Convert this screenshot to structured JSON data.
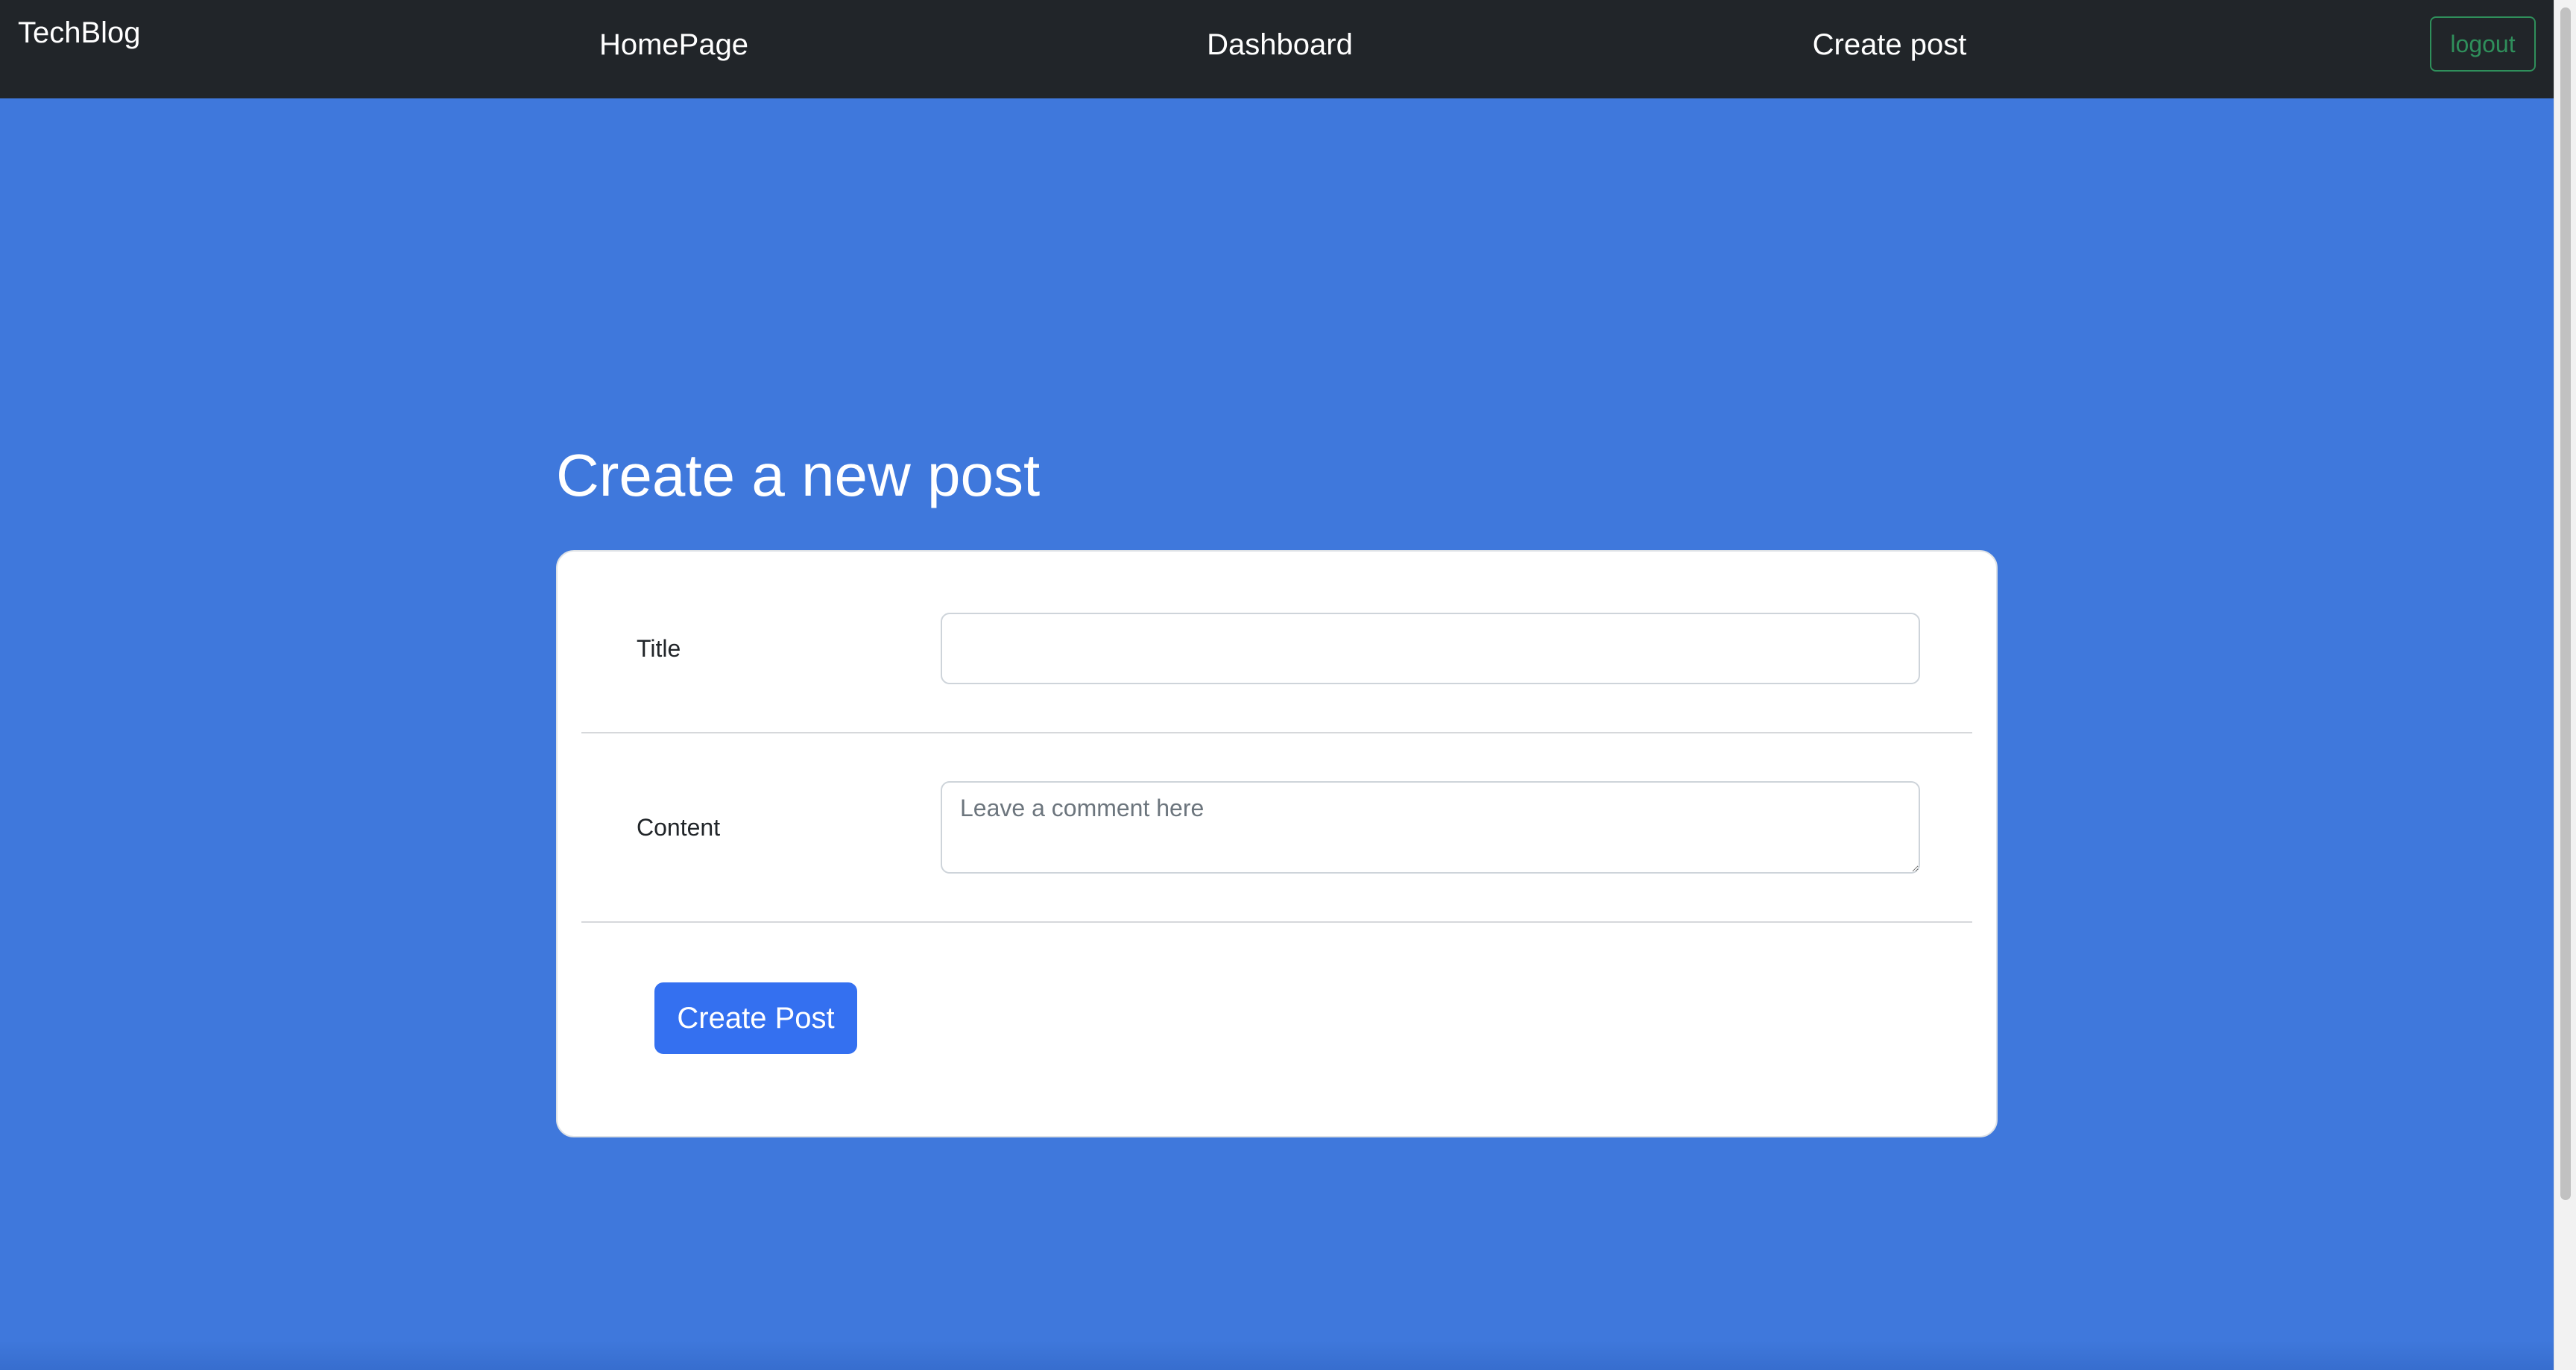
{
  "navbar": {
    "brand": "TechBlog",
    "links": [
      {
        "label": "HomePage"
      },
      {
        "label": "Dashboard"
      },
      {
        "label": "Create post"
      }
    ],
    "logout_label": "logout"
  },
  "page": {
    "heading": "Create a new post"
  },
  "form": {
    "title_label": "Title",
    "title_value": "",
    "content_label": "Content",
    "content_placeholder": "Leave a comment here",
    "content_value": "",
    "submit_label": "Create Post"
  },
  "colors": {
    "background": "#3f78dc",
    "navbar": "#212529",
    "primary_button": "#3470f0",
    "logout_outline": "#2f8f5b"
  }
}
